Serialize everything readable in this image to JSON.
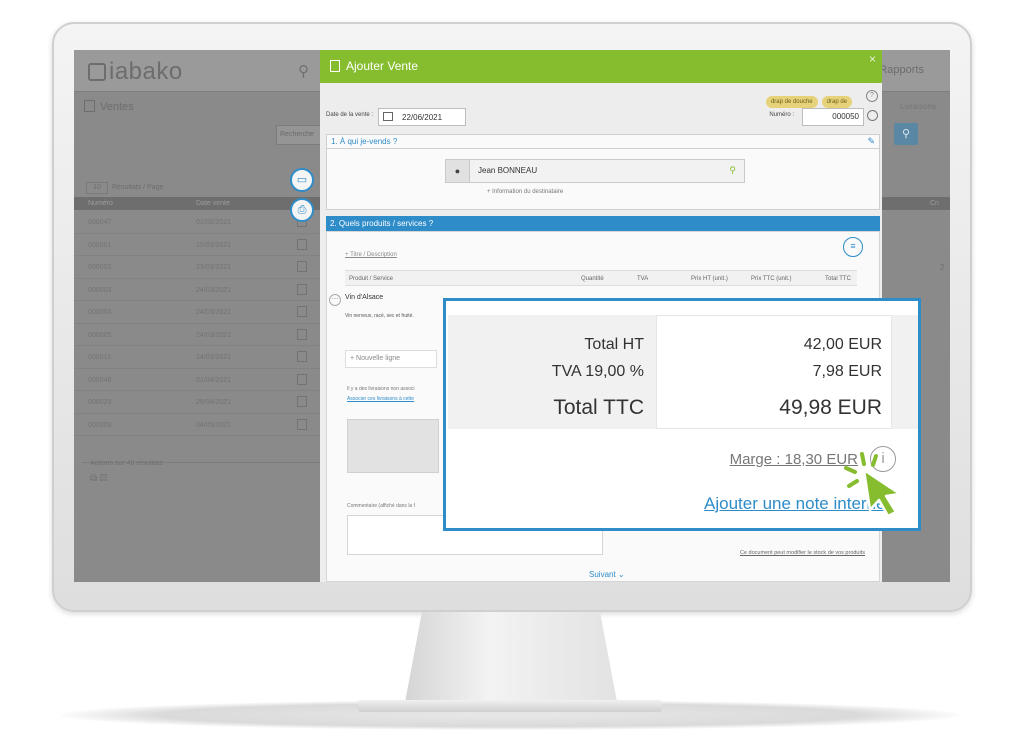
{
  "app": {
    "logo": "iabako",
    "menu_rapports": "Rapports",
    "page_title": "Ventes",
    "livraisons_tab": "Livraisons",
    "filter_placeholder": "Recherche",
    "results_per_page_value": "10",
    "results_per_page_label": "Résultats / Page",
    "columns": [
      "Numéro",
      "Date vente",
      "Cn"
    ],
    "rows": [
      {
        "num": "000047",
        "date": "01/02/2021"
      },
      {
        "num": "000001",
        "date": "15/03/2021"
      },
      {
        "num": "000002",
        "date": "23/03/2021"
      },
      {
        "num": "000003",
        "date": "24/03/2021"
      },
      {
        "num": "000004",
        "date": "24/03/2021"
      },
      {
        "num": "000005",
        "date": "24/03/2021"
      },
      {
        "num": "000011",
        "date": "24/03/2021"
      },
      {
        "num": "000048",
        "date": "01/04/2021"
      },
      {
        "num": "000029",
        "date": "29/04/2021"
      },
      {
        "num": "000009",
        "date": "04/05/2021"
      }
    ],
    "actions_label": "Actions sur 40 résultats",
    "side_number": "2"
  },
  "modal": {
    "title": "Ajouter Vente",
    "close": "×",
    "tags": [
      "drap de douche",
      "drap de"
    ],
    "date_label": "Date de la vente :",
    "date_value": "22/06/2021",
    "numero_label": "Numéro :",
    "numero_value": "000050",
    "section1_title": "1. À qui je-vends ?",
    "client_name": "Jean BONNEAU",
    "info_destinataire": "+ Information du destinataire",
    "section2_title": "2. Quels produits / services ?",
    "titre_description": "+ Titre / Description",
    "table_headers": [
      "Produit / Service",
      "Quantité",
      "TVA",
      "Prix HT (unit.)",
      "Prix TTC (unit.)",
      "Total TTC"
    ],
    "product_name": "Vin d'Alsace",
    "product_desc": "Vin nerveux, racé, sec et fruité.",
    "new_line": "+ Nouvelle ligne",
    "livraisons_text": "Il y a des livraisons non associ",
    "livraisons_link": "Associer ces livraisons à cette",
    "comment_label": "Commentaire (affiché dans la f",
    "stock_note": "Ce document peut modifier le stock de vos produits",
    "suivant": "Suivant"
  },
  "zoom": {
    "total_ht_label": "Total HT",
    "total_ht_value": "42,00 EUR",
    "tva_label": "TVA 19,00 %",
    "tva_value": "7,98 EUR",
    "total_ttc_label": "Total TTC",
    "total_ttc_value": "49,98 EUR",
    "marge": "Marge : 18,30 EUR",
    "note_link": "Ajouter une note interne"
  },
  "colors": {
    "accent_blue": "#2e8cc9",
    "header_green": "#86bd2f"
  }
}
